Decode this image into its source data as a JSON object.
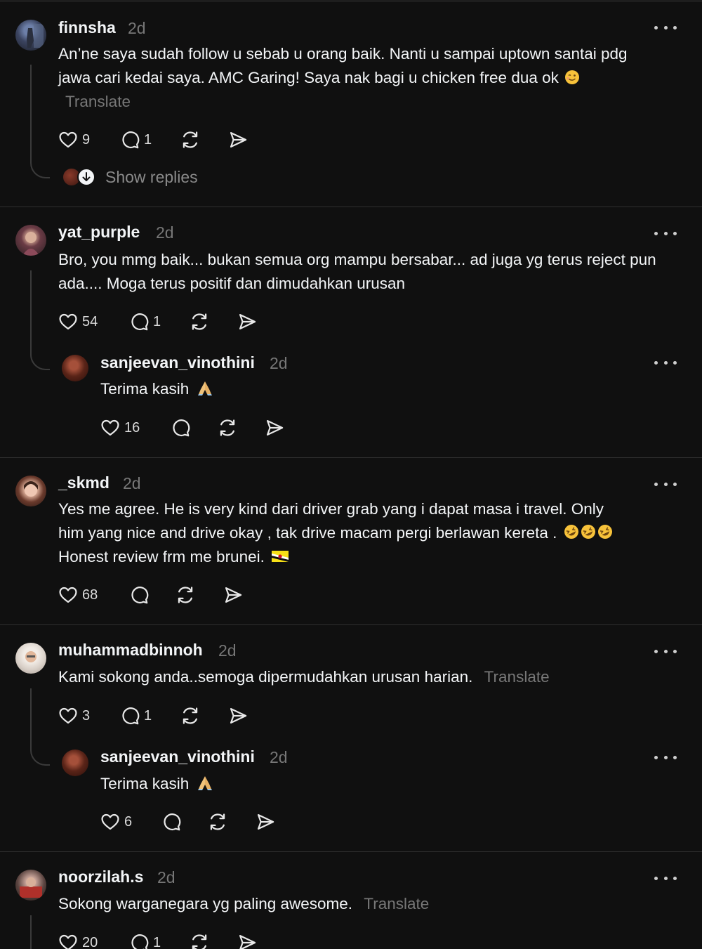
{
  "posts": [
    {
      "username": "finnsha",
      "time": "2d",
      "text": "An’ne saya sudah follow u sebab u orang baik. Nanti u sampai uptown santai pdg jawa cari kedai saya. AMC Garing! Saya nak bagi u chicken free dua ok",
      "translate": "Translate",
      "likes": "9",
      "replies": "1",
      "show_replies": "Show replies"
    },
    {
      "username": "yat_purple",
      "time": "2d",
      "text": "Bro, you mmg baik... bukan semua org mampu bersabar... ad juga yg terus reject pun ada.... Moga terus positif dan dimudahkan urusan",
      "likes": "54",
      "replies": "1",
      "reply": {
        "username": "sanjeevan_vinothini",
        "time": "2d",
        "text": "Terima kasih",
        "likes": "16"
      }
    },
    {
      "username": "_skmd",
      "time": "2d",
      "text_line1": "Yes me agree. He is very kind dari driver grab yang i dapat masa i travel. Only",
      "text_line2": "him yang nice and drive okay , tak drive macam pergi berlawan kereta .",
      "text_line3": "Honest review frm me brunei.",
      "likes": "68"
    },
    {
      "username": "muhammadbinnoh",
      "time": "2d",
      "text": "Kami sokong anda..semoga dipermudahkan urusan harian.",
      "translate": "Translate",
      "likes": "3",
      "replies": "1",
      "reply": {
        "username": "sanjeevan_vinothini",
        "time": "2d",
        "text": "Terima kasih",
        "likes": "6"
      }
    },
    {
      "username": "noorzilah.s",
      "time": "2d",
      "text": "Sokong warganegara yg paling awesome.",
      "translate": "Translate",
      "likes": "20",
      "replies": "1"
    }
  ],
  "icons": [
    "heart-icon",
    "comment-icon",
    "repost-icon",
    "share-icon",
    "more-icon"
  ],
  "colors": {
    "background": "#101010",
    "text": "#f3f5f7",
    "muted": "#777777",
    "divider": "#2f2f2f"
  }
}
